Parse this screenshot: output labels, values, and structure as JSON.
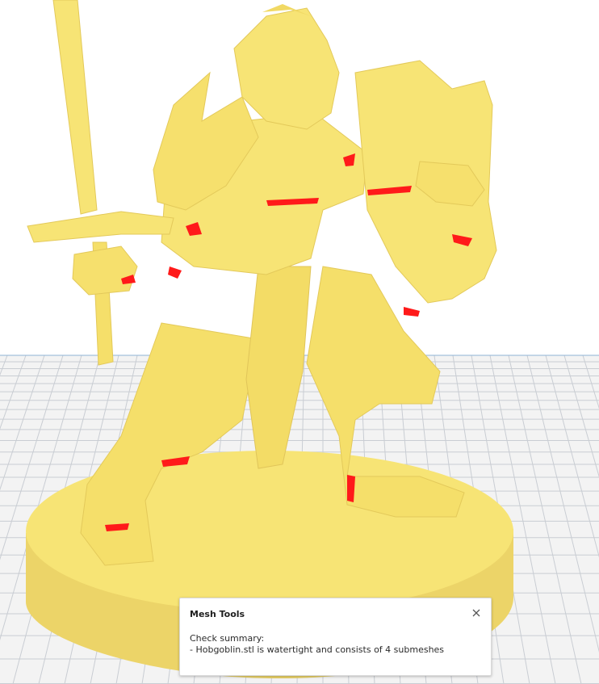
{
  "viewport": {
    "background_top": "#ffffff",
    "background_floor": "#f3f3f3",
    "grid_color": "#c9cdd3",
    "model_color": "#f7e475",
    "model_shade": "#e0c85a",
    "overhang_color": "#ff1a1a"
  },
  "notification": {
    "title": "Mesh Tools",
    "close_icon": "close-icon",
    "summary_heading": "Check summary:",
    "summary_line": "- Hobgoblin.stl is watertight and consists of 4 submeshes"
  }
}
